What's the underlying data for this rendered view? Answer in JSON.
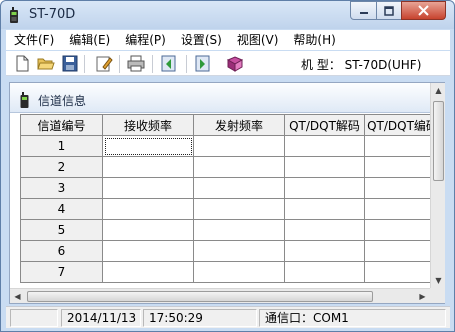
{
  "window": {
    "title": "ST-70D"
  },
  "menu": [
    {
      "label": "文件(F)"
    },
    {
      "label": "编辑(E)"
    },
    {
      "label": "编程(P)"
    },
    {
      "label": "设置(S)"
    },
    {
      "label": "视图(V)"
    },
    {
      "label": "帮助(H)"
    }
  ],
  "toolbar": {
    "buttons": [
      "new-file-icon",
      "open-folder-icon",
      "save-icon",
      "edit-icon",
      "print-icon",
      "read-radio-icon",
      "write-radio-icon",
      "help-book-icon"
    ],
    "model_label": "机 型： ST-70D(UHF)"
  },
  "panel": {
    "title": "信道信息"
  },
  "grid": {
    "columns": [
      "信道编号",
      "接收频率",
      "发射频率",
      "QT/DQT解码",
      "QT/DQT编码"
    ],
    "rows": [
      {
        "channel": "1",
        "rx": "",
        "tx": "",
        "decode": "",
        "encode": ""
      },
      {
        "channel": "2",
        "rx": "",
        "tx": "",
        "decode": "",
        "encode": ""
      },
      {
        "channel": "3",
        "rx": "",
        "tx": "",
        "decode": "",
        "encode": ""
      },
      {
        "channel": "4",
        "rx": "",
        "tx": "",
        "decode": "",
        "encode": ""
      },
      {
        "channel": "5",
        "rx": "",
        "tx": "",
        "decode": "",
        "encode": ""
      },
      {
        "channel": "6",
        "rx": "",
        "tx": "",
        "decode": "",
        "encode": ""
      },
      {
        "channel": "7",
        "rx": "",
        "tx": "",
        "decode": "",
        "encode": ""
      }
    ],
    "selected_cell": {
      "row": 1,
      "column": "接收频率"
    }
  },
  "statusbar": {
    "date": "2014/11/13",
    "time": "17:50:29",
    "port": "通信口：COM1"
  },
  "colors": {
    "frame": "#c9dcf2",
    "close_button": "#c7432e",
    "grid_header": "#f0f0f0"
  }
}
